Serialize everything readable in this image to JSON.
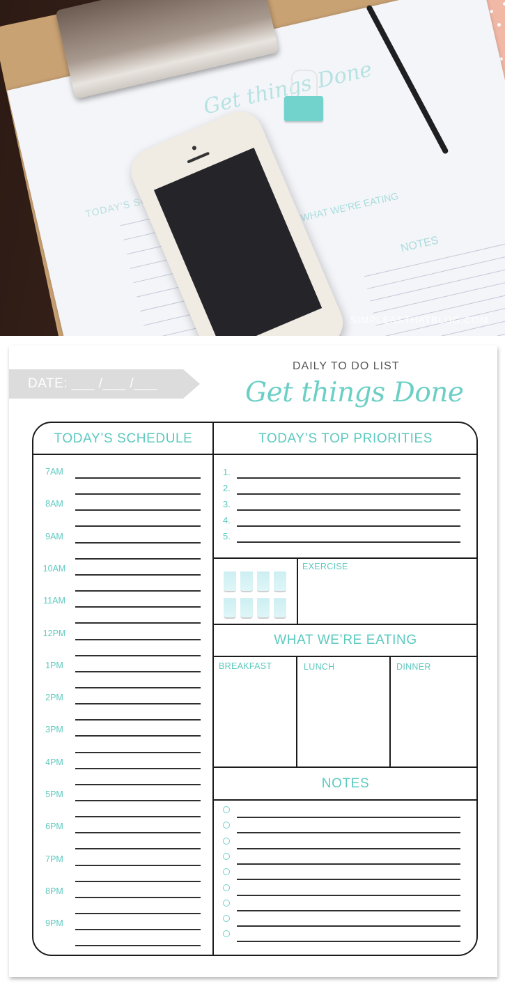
{
  "photo": {
    "watermark": "SIMPLEASTHATBLOG.COM",
    "paper_title": "Get things Done",
    "paper_schedule": "TODAY'S SCHEDULE",
    "paper_eating": "WHAT WE'RE EATING",
    "paper_notes": "NOTES"
  },
  "printable": {
    "date_label": "DATE: ___ /___ /___",
    "subtitle": "DAILY TO DO LIST",
    "title": "Get things Done",
    "colors": {
      "accent": "#5cc9bf",
      "banner": "#dcdcdc",
      "lines": "#1b1b1b"
    },
    "schedule": {
      "heading": "TODAY’S SCHEDULE",
      "times": [
        "7AM",
        "8AM",
        "9AM",
        "10AM",
        "11AM",
        "12PM",
        "1PM",
        "2PM",
        "3PM",
        "4PM",
        "5PM",
        "6PM",
        "7PM",
        "8PM",
        "9PM"
      ]
    },
    "priorities": {
      "heading": "TODAY’S TOP PRIORITIES",
      "items": [
        "1.",
        "2.",
        "3.",
        "4.",
        "5."
      ]
    },
    "water": {
      "glasses": 8
    },
    "exercise": {
      "label": "EXERCISE"
    },
    "eating": {
      "heading": "WHAT WE’RE EATING",
      "meals": [
        "BREAKFAST",
        "LUNCH",
        "DINNER"
      ]
    },
    "notes": {
      "heading": "NOTES",
      "bullets": 9
    }
  }
}
